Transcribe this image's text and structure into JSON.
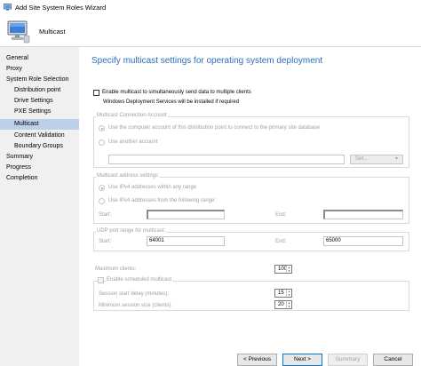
{
  "window": {
    "title": "Add Site System Roles Wizard"
  },
  "header": {
    "page_name": "Multicast"
  },
  "nav": {
    "items": [
      {
        "label": "General",
        "indent": 0
      },
      {
        "label": "Proxy",
        "indent": 0
      },
      {
        "label": "System Role Selection",
        "indent": 0
      },
      {
        "label": "Distribution point",
        "indent": 1
      },
      {
        "label": "Drive Settings",
        "indent": 1
      },
      {
        "label": "PXE Settings",
        "indent": 1
      },
      {
        "label": "Multicast",
        "indent": 1,
        "active": true
      },
      {
        "label": "Content Validation",
        "indent": 1
      },
      {
        "label": "Boundary Groups",
        "indent": 1
      },
      {
        "label": "Summary",
        "indent": 0
      },
      {
        "label": "Progress",
        "indent": 0
      },
      {
        "label": "Completion",
        "indent": 0
      }
    ]
  },
  "main": {
    "heading": "Specify multicast settings for operating system deployment",
    "enable_multicast": {
      "label": "Enable multicast to simultaneously send data to multiple clients",
      "note": "Windows Deployment Services will be installed if required",
      "checked": false
    },
    "connection_account": {
      "legend": "Multicast Connection Account",
      "option_computer": "Use the computer account of this distribution point to connect to the primary site database",
      "option_other": "Use another account",
      "account_value": "",
      "set_button": "Set..."
    },
    "address_settings": {
      "legend": "Multicast address settings",
      "option_any": "Use IPv4 addresses within any range",
      "option_range": "Use IPv4 addresses from the following range:",
      "start_label": "Start:",
      "end_label": "End:",
      "start_value": "",
      "end_value": ""
    },
    "udp_range": {
      "legend": "UDP port range for multicast:",
      "start_label": "Start:",
      "start_value": "64001",
      "end_label": "End:",
      "end_value": "65000"
    },
    "max_clients": {
      "label": "Maximum clients:",
      "value": "100"
    },
    "scheduled": {
      "label": "Enable scheduled multicast",
      "delay_label": "Session start delay (minutes):",
      "delay_value": "15",
      "min_size_label": "Minimum session size (clients):",
      "min_size_value": "20"
    }
  },
  "buttons": {
    "previous": "< Previous",
    "next": "Next >",
    "summary": "Summary",
    "cancel": "Cancel"
  },
  "colors": {
    "heading": "#2a6ebb",
    "nav_bg": "#f0f0f0",
    "nav_active": "#bcd0ea"
  }
}
